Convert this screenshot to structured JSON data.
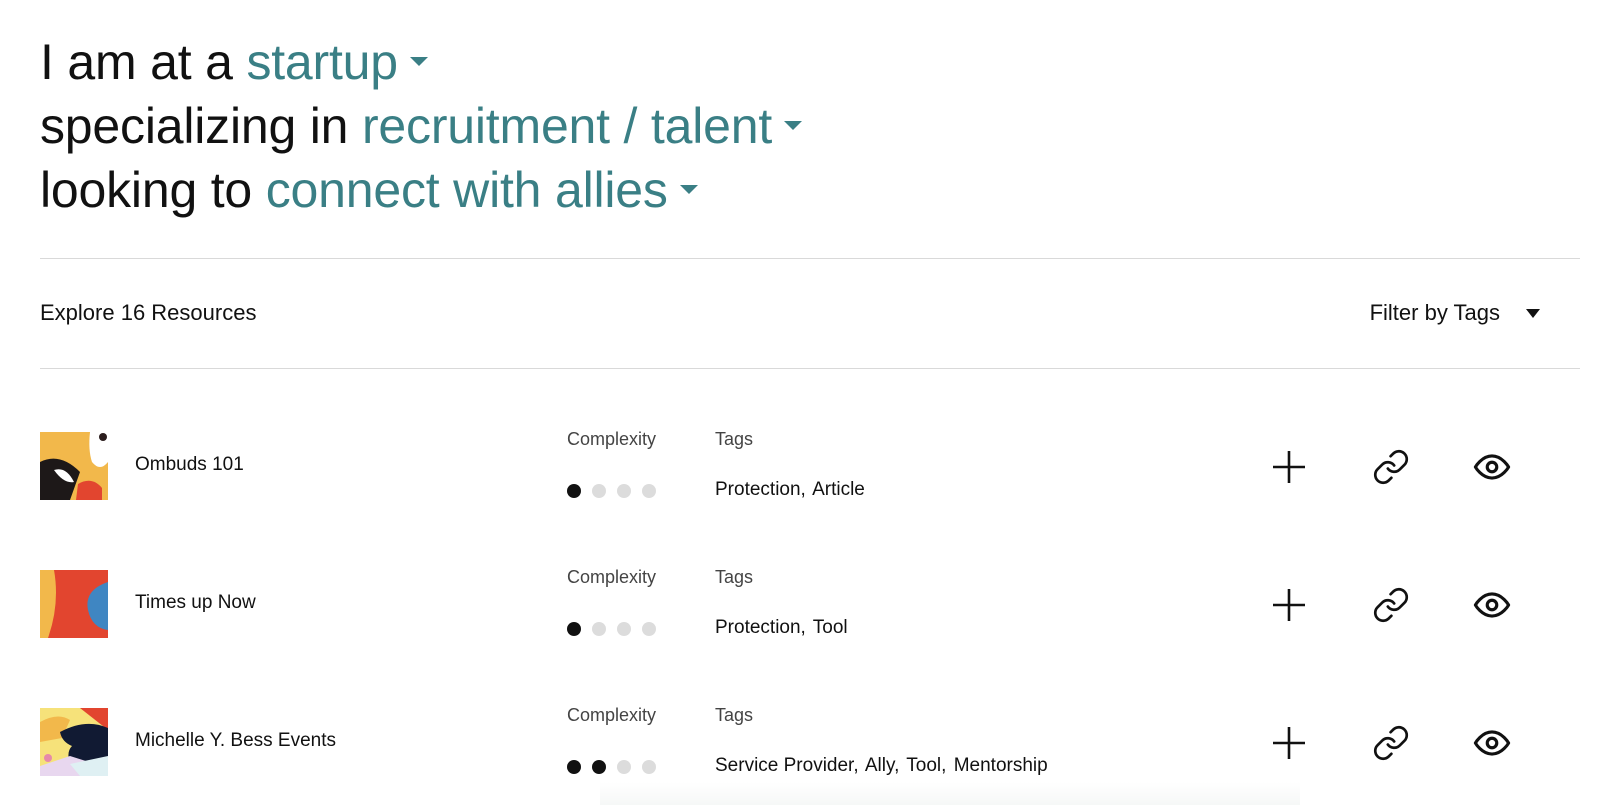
{
  "header": {
    "line1_prefix": "I am at a",
    "line1_value": "startup",
    "line2_prefix": "specializing in",
    "line2_value": "recruitment / talent",
    "line3_prefix": "looking to",
    "line3_value": "connect with allies"
  },
  "toolbar": {
    "explore_label": "Explore 16 Resources",
    "filter_label": "Filter by Tags"
  },
  "columns": {
    "complexity_label": "Complexity",
    "tags_label": "Tags"
  },
  "resources": [
    {
      "title": "Ombuds 101",
      "complexity_level": 1,
      "complexity_max": 4,
      "tags": [
        "Protection,",
        "Article"
      ]
    },
    {
      "title": "Times up Now",
      "complexity_level": 1,
      "complexity_max": 4,
      "tags": [
        "Protection,",
        "Tool"
      ]
    },
    {
      "title": "Michelle Y. Bess Events",
      "complexity_level": 2,
      "complexity_max": 4,
      "tags": [
        "Service Provider,",
        "Ally,",
        "Tool,",
        "Mentorship"
      ]
    }
  ],
  "icons": {
    "add": "plus-icon",
    "link": "link-icon",
    "view": "eye-icon",
    "dropdown": "caret-down-icon"
  },
  "colors": {
    "accent": "#3a7f85",
    "dot_active": "#111111",
    "dot_inactive": "#dcdcdc",
    "divider": "#d9d9d9"
  }
}
